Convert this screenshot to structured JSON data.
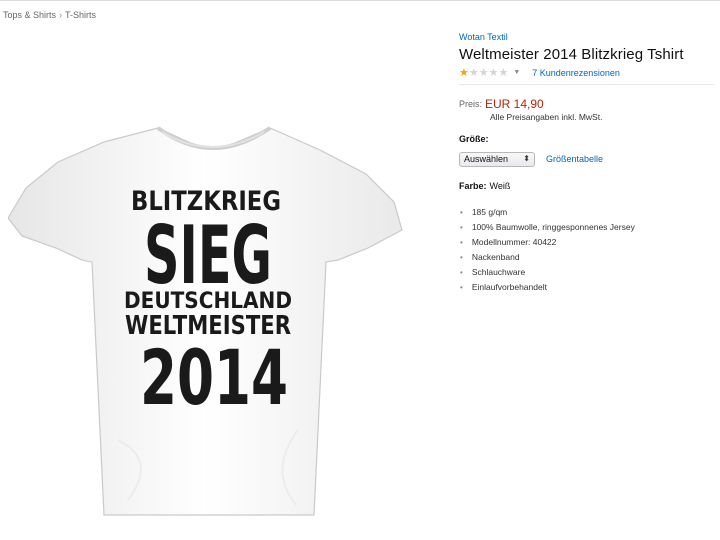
{
  "breadcrumb": {
    "items": [
      "Tops & Shirts",
      "T-Shirts"
    ],
    "separator": "›"
  },
  "product": {
    "brand": "Wotan Textil",
    "title": "Weltmeister 2014 Blitzkrieg Tshirt",
    "rating": {
      "stars": 1,
      "max": 5,
      "reviews_label": "7 Kundenrezensionen"
    },
    "price_label": "Preis:",
    "price": "EUR 14,90",
    "tax_note": "Alle Preisangaben inkl. MwSt.",
    "size_label": "Größe:",
    "size_select": "Auswählen",
    "size_chart": "Größentabelle",
    "color_label": "Farbe:",
    "color_value": "Weiß",
    "features": [
      "185 g/qm",
      "100% Baumwolle, ringgesponnenes Jersey",
      "Modellnummer: 40422",
      "Nackenband",
      "Schlauchware",
      "Einlaufvorbehandelt"
    ],
    "image_print": [
      "BLITZKRIEG",
      "SIEG",
      "DEUTSCHLAND",
      "WELTMEISTER",
      "2014"
    ]
  },
  "colors": {
    "link": "#0066c0",
    "price": "#b12704",
    "star": "#f0a31a"
  },
  "icons": {
    "select_arrow": "updown-arrow-icon",
    "dropdown": "chevron-down-icon"
  }
}
